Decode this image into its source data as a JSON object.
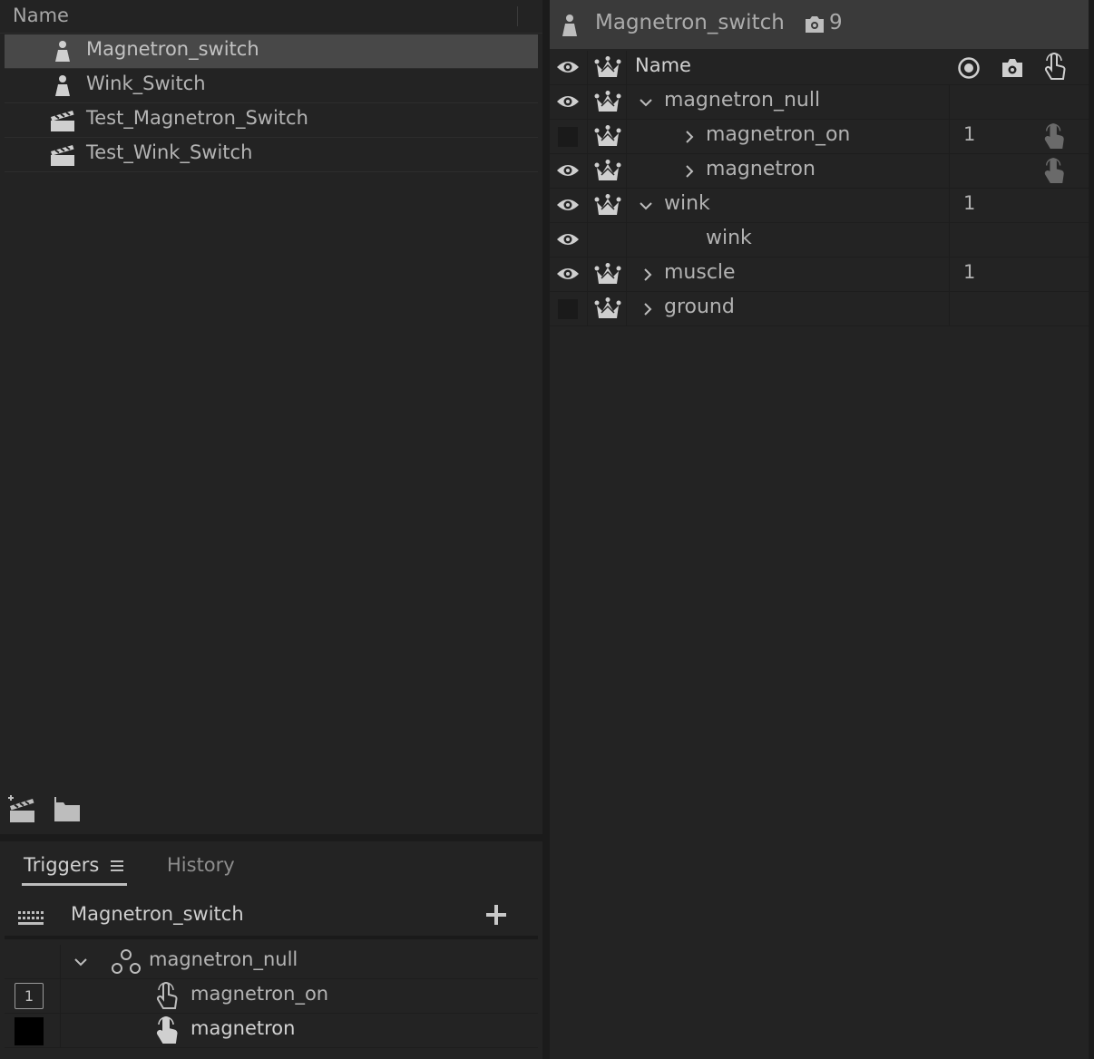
{
  "project": {
    "column_header": "Name",
    "items": [
      {
        "label": "Magnetron_switch",
        "type": "puppet",
        "selected": true
      },
      {
        "label": "Wink_Switch",
        "type": "puppet",
        "selected": false
      },
      {
        "label": "Test_Magnetron_Switch",
        "type": "scene",
        "selected": false
      },
      {
        "label": "Test_Wink_Switch",
        "type": "scene",
        "selected": false
      }
    ],
    "footer_icons": [
      "new-scene-icon",
      "new-folder-icon"
    ]
  },
  "triggers_panel": {
    "tabs": [
      {
        "label": "Triggers",
        "active": true
      },
      {
        "label": "History",
        "active": false
      }
    ],
    "puppet_name": "Magnetron_switch",
    "rows": [
      {
        "label": "magnetron_null",
        "key": "",
        "kind": "group",
        "expanded": true
      },
      {
        "label": "magnetron_on",
        "key": "1",
        "kind": "trigger"
      },
      {
        "label": "magnetron",
        "key": "",
        "kind": "trigger-swatch"
      }
    ]
  },
  "puppet_panel": {
    "title": "Magnetron_switch",
    "behavior_count": "9",
    "header": {
      "name_label": "Name"
    },
    "layers": [
      {
        "name": "magnetron_null",
        "visible": true,
        "crown": true,
        "twirl": "down",
        "indent": 0,
        "value": "",
        "trigger_icon": false
      },
      {
        "name": "magnetron_on",
        "visible": false,
        "crown": true,
        "twirl": "right",
        "indent": 1,
        "value": "1",
        "trigger_icon": true
      },
      {
        "name": "magnetron",
        "visible": true,
        "crown": true,
        "twirl": "right",
        "indent": 1,
        "value": "",
        "trigger_icon": true
      },
      {
        "name": "wink",
        "visible": true,
        "crown": true,
        "twirl": "down",
        "indent": 0,
        "value": "1",
        "trigger_icon": false
      },
      {
        "name": "wink",
        "visible": true,
        "crown": false,
        "twirl": "none",
        "indent": 1,
        "value": "",
        "trigger_icon": false
      },
      {
        "name": "muscle",
        "visible": true,
        "crown": true,
        "twirl": "right",
        "indent": 0,
        "value": "1",
        "trigger_icon": false
      },
      {
        "name": "ground",
        "visible": false,
        "crown": true,
        "twirl": "right",
        "indent": 0,
        "value": "",
        "trigger_icon": false
      }
    ]
  },
  "colors": {
    "panel_bg": "#232323",
    "titlebar_bg": "#3a3a3a",
    "selected_row": "#484848",
    "text": "#b4b4b4"
  }
}
